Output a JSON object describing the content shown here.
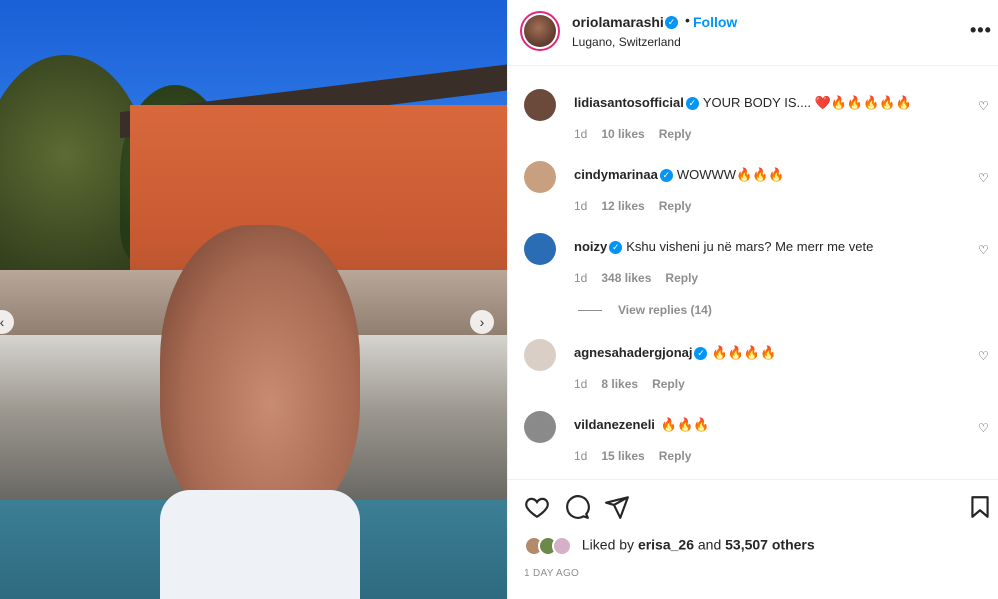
{
  "post": {
    "username": "oriolamarashi",
    "follow_label": "Follow",
    "dot": "•",
    "location": "Lugano, Switzerland",
    "more": "•••"
  },
  "carousel": {
    "prev": "‹",
    "next": "›"
  },
  "comments": [
    {
      "user": "lidiasantosofficial",
      "text": "YOUR BODY IS.... ❤️🔥🔥🔥🔥🔥",
      "age": "1d",
      "likes": "10 likes",
      "reply": "Reply",
      "avatar_color": "#6b4a3c"
    },
    {
      "user": "cindymarinaa",
      "text": "WOWWW🔥🔥🔥",
      "age": "1d",
      "likes": "12 likes",
      "reply": "Reply",
      "avatar_color": "#c9a07f"
    },
    {
      "user": "noizy",
      "text": "Kshu visheni ju në mars? Me merr me vete",
      "age": "1d",
      "likes": "348 likes",
      "reply": "Reply",
      "avatar_color": "#2a6db5"
    },
    {
      "user": "agnesahadergjonaj",
      "text": "🔥🔥🔥🔥",
      "age": "1d",
      "likes": "8 likes",
      "reply": "Reply",
      "avatar_color": "#d9cfc6"
    },
    {
      "user": "vildanezeneli",
      "text": "🔥🔥🔥",
      "age": "1d",
      "likes": "15 likes",
      "reply": "Reply",
      "avatar_color": "#8a8a8a"
    }
  ],
  "view_replies": "View replies (14)",
  "likes_summary": {
    "prefix": "Liked by ",
    "user": "erisa_26",
    "middle": " and ",
    "count": "53,507 others"
  },
  "time_ago": "1 DAY AGO",
  "colors": {
    "accent": "#0095f6",
    "text": "#262626",
    "muted": "#8e8e8e"
  },
  "icons": [
    "like-icon",
    "comment-icon",
    "share-icon",
    "save-icon",
    "more-icon",
    "verified-icon",
    "heart-small-icon"
  ]
}
